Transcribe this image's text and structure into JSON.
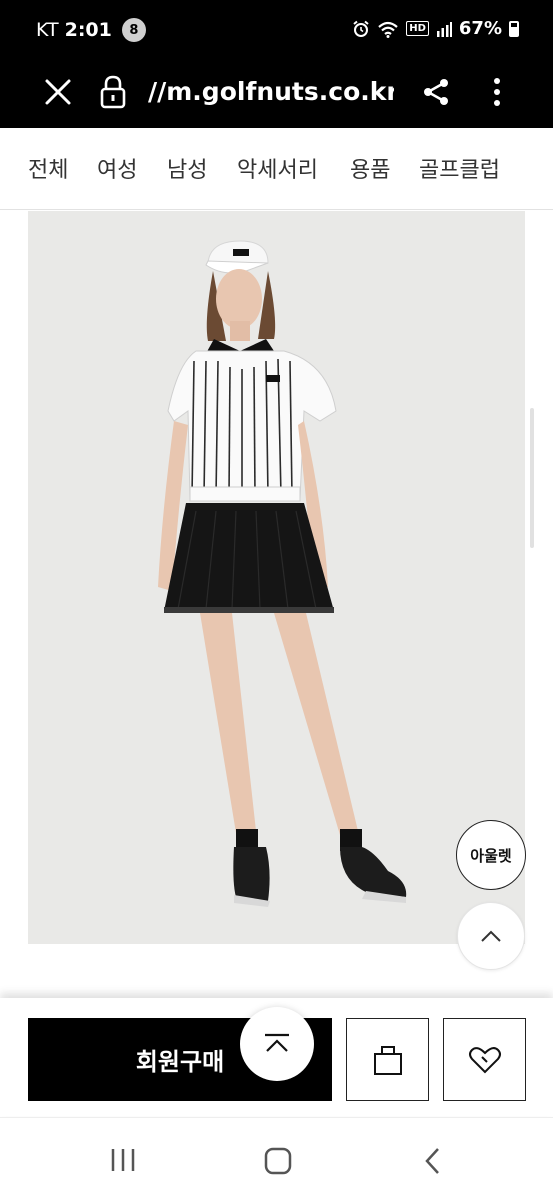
{
  "status_bar": {
    "carrier": "KT",
    "time": "2:01",
    "notification_count": "8",
    "hd_label": "HD",
    "battery_percent": "67%"
  },
  "url_bar": {
    "url": "//m.golfnuts.co.kr/p"
  },
  "category_nav": {
    "items": [
      "전체",
      "여성",
      "남성",
      "악세서리",
      "용품",
      "골프클럽"
    ]
  },
  "floating": {
    "outlet_label": "아울렛"
  },
  "purchase_bar": {
    "member_buy_label": "회원구매"
  },
  "icons": {
    "close": "close-icon",
    "lock": "lock-icon",
    "share": "share-icon",
    "menu": "more-vertical-icon",
    "scroll_up": "chevron-up-icon",
    "cart": "shopping-bag-icon",
    "wish": "heart-icon",
    "page_top": "scroll-to-top-icon",
    "recents": "recents-icon",
    "home": "home-icon",
    "back": "back-icon"
  },
  "colors": {
    "bar_background": "#000000",
    "image_background": "#e9e9e7",
    "nav_text": "#333333"
  }
}
